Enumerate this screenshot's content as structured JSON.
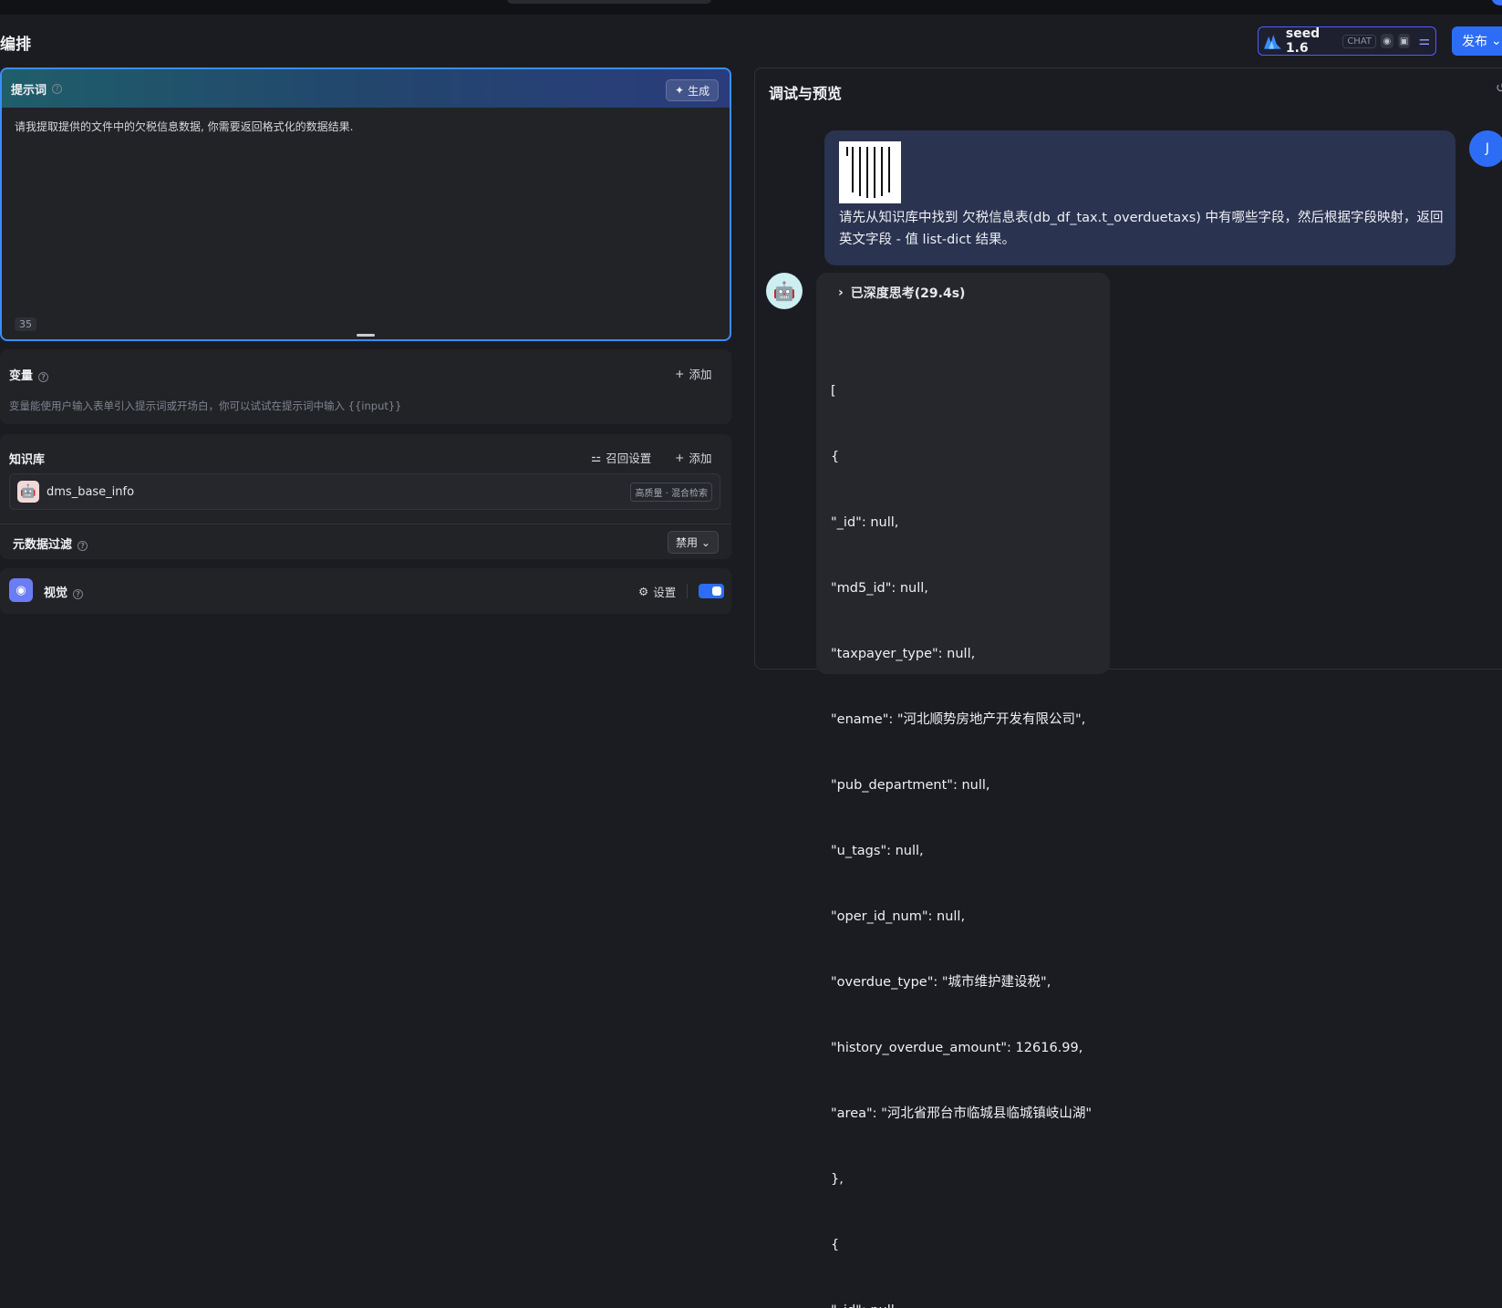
{
  "header": {
    "title": "编排",
    "model": {
      "name": "seed 1.6",
      "tag": "CHAT"
    },
    "publish_label": "发布"
  },
  "prompt": {
    "label": "提示词",
    "generate_label": "生成",
    "text": "请我提取提供的文件中的欠税信息数据, 你需要返回格式化的数据结果.",
    "char_count": "35"
  },
  "variables": {
    "label": "变量",
    "add_label": "添加",
    "hint": "变量能使用户输入表单引入提示词或开场白，你可以试试在提示词中输入 {{input}}"
  },
  "knowledge": {
    "label": "知识库",
    "recall_label": "召回设置",
    "add_label": "添加",
    "item_name": "dms_base_info",
    "item_badge": "高质量 · 混合检索",
    "meta_filter_label": "元数据过滤",
    "meta_filter_value": "禁用"
  },
  "vision": {
    "label": "视觉",
    "settings_label": "设置",
    "enabled": true
  },
  "preview": {
    "title": "调试与预览",
    "user_initial": "J",
    "user_message": "请先从知识库中找到 欠税信息表(db_df_tax.t_overduetaxs) 中有哪些字段，然后根据字段映射，返回 英文字段 - 值 list-dict 结果。",
    "thinking_label": "已深度思考(29.4s)",
    "reply_lines": [
      "[",
      "{",
      "\"_id\": null,",
      "\"md5_id\": null,",
      "\"taxpayer_type\": null,",
      "\"ename\": \"河北顺势房地产开发有限公司\",",
      "\"pub_department\": null,",
      "\"u_tags\": null,",
      "\"oper_id_num\": null,",
      "\"overdue_type\": \"城市维护建设税\",",
      "\"history_overdue_amount\": 12616.99,",
      "\"area\": \"河北省邢台市临城县临城镇岐山湖\"",
      "},",
      "{",
      "\"_id\": null,"
    ]
  }
}
